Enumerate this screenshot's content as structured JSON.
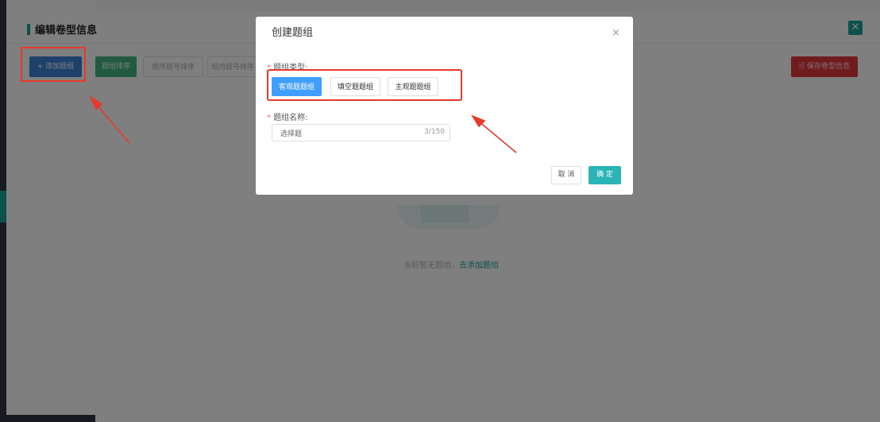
{
  "page": {
    "title": "编辑卷型信息",
    "close_icon": "✕"
  },
  "toolbar": {
    "add_group": "+ 添加题组",
    "sort_groups": "题组排序",
    "sort_sequential": "顺序题号排序",
    "sort_in_group": "组内题号排序",
    "save": "保存卷型信息"
  },
  "empty_state": {
    "text": "当前暂无题组，",
    "link": "去添加题组"
  },
  "modal": {
    "title": "创建题组",
    "close": "×",
    "type_label": "题组类型:",
    "type_options": [
      "客观题题组",
      "填空题题组",
      "主观题题组"
    ],
    "selected_type": "客观题题组",
    "name_label": "题组名称:",
    "name_value": "选择题",
    "name_count": "3/150",
    "cancel": "取 消",
    "confirm": "确 定",
    "required_mark": "*"
  },
  "colors": {
    "accent": "#1aa39a",
    "primary": "#409eff",
    "danger": "#e0393e",
    "annotation": "#e8392b"
  },
  "icons": {
    "save_icon": "document-icon",
    "close_icon": "close-icon"
  }
}
